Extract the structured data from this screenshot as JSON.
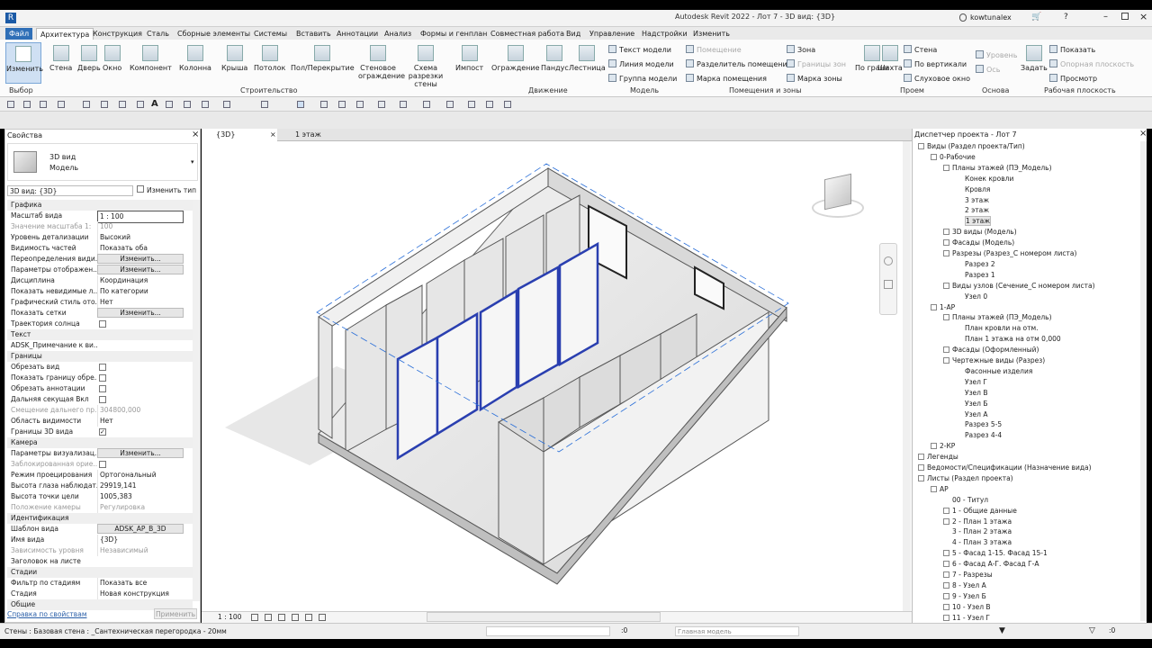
{
  "window": {
    "title": "Autodesk Revit 2022 - Лот 7 - 3D вид: {3D}",
    "user": "kowtunalex"
  },
  "tabs": [
    "Файл",
    "Архитектура",
    "Конструкция",
    "Сталь",
    "Сборные элементы",
    "Системы",
    "Вставить",
    "Аннотации",
    "Анализ",
    "Формы и генплан",
    "Совместная работа",
    "Вид",
    "Управление",
    "Надстройки",
    "Изменить"
  ],
  "ribbon": {
    "select": {
      "modify": "Изменить",
      "select_label": "Выбор"
    },
    "build": [
      "Стена",
      "Дверь",
      "Окно",
      "Компонент",
      "Колонна",
      "Крыша",
      "Потолок",
      "Пол/Перекрытие",
      "Стеновое ограждение",
      "Схема разрезки стены",
      "Импост",
      "Ограждение",
      "Пандус",
      "Лестница"
    ],
    "model_items": [
      "Текст модели",
      "Линия модели",
      "Группа модели"
    ],
    "room_items": [
      "Помещение",
      "Разделитель помещений",
      "Марка помещения"
    ],
    "area_items": [
      "Зона",
      "Границы зон",
      "Марка зоны"
    ],
    "opening_items": [
      "По грани",
      "Шахта",
      "Стена",
      "По вертикали",
      "Слуховое окно"
    ],
    "datum_items": [
      "Уровень",
      "Ось"
    ],
    "wp_items": [
      "Задать",
      "Показать",
      "Опорная плоскость",
      "Просмотр"
    ],
    "groups": [
      "Строительство",
      "Движение",
      "Модель",
      "Помещения и зоны",
      "Проем",
      "Основа",
      "Рабочая плоскость"
    ]
  },
  "properties": {
    "title": "Свойства",
    "type_name": "3D вид",
    "type_sub": "Модель",
    "selector": "3D вид: {3D}",
    "edit_type": "Изменить тип",
    "sections": [
      {
        "name": "Графика",
        "rows": [
          [
            "Масштаб вида",
            "1 : 100"
          ],
          [
            "Значение масштаба    1:",
            "100"
          ],
          [
            "Уровень детализации",
            "Высокий"
          ],
          [
            "Видимость частей",
            "Показать оба"
          ],
          [
            "Переопределения види...",
            "Изменить..."
          ],
          [
            "Параметры отображен...",
            "Изменить..."
          ],
          [
            "Дисциплина",
            "Координация"
          ],
          [
            "Показать невидимые л...",
            "По категории"
          ],
          [
            "Графический стиль ото...",
            "Нет"
          ],
          [
            "Показать сетки",
            "Изменить..."
          ],
          [
            "Траектория солнца",
            ""
          ]
        ]
      },
      {
        "name": "Текст",
        "rows": [
          [
            "ADSK_Примечание к ви...",
            ""
          ]
        ]
      },
      {
        "name": "Границы",
        "rows": [
          [
            "Обрезать вид",
            ""
          ],
          [
            "Показать границу обре...",
            ""
          ],
          [
            "Обрезать аннотации",
            ""
          ],
          [
            "Дальняя секущая Вкл",
            ""
          ],
          [
            "Смещение дальнего пр...",
            "304800,000"
          ],
          [
            "Область видимости",
            "Нет"
          ],
          [
            "Границы 3D вида",
            ""
          ]
        ]
      },
      {
        "name": "Камера",
        "rows": [
          [
            "Параметры визуализац...",
            "Изменить..."
          ],
          [
            "Заблокированная орие...",
            ""
          ],
          [
            "Режим проецирования",
            "Ортогональный"
          ],
          [
            "Высота глаза наблюдат...",
            "29919,141"
          ],
          [
            "Высота точки цели",
            "1005,383"
          ],
          [
            "Положение камеры",
            "Регулировка"
          ]
        ]
      },
      {
        "name": "Идентификация",
        "rows": [
          [
            "Шаблон вида",
            "ADSK_АР_В_3D"
          ],
          [
            "Имя вида",
            "{3D}"
          ],
          [
            "Зависимость уровня",
            "Независимый"
          ],
          [
            "Заголовок на листе",
            ""
          ]
        ]
      },
      {
        "name": "Стадии",
        "rows": [
          [
            "Фильтр по стадиям",
            "Показать все"
          ],
          [
            "Стадия",
            "Новая конструкция"
          ]
        ]
      },
      {
        "name": "Общие",
        "rows": []
      }
    ],
    "help_link": "Справка по свойствам",
    "apply": "Применить"
  },
  "view_tabs": [
    "{3D}",
    "1 этаж"
  ],
  "view_scale": "1 : 100",
  "browser": {
    "title": "Диспетчер проекта - Лот 7",
    "nodes": [
      [
        "Виды (Раздел проекта/Тип)",
        0,
        "minus"
      ],
      [
        "0-Рабочие",
        1,
        "minus"
      ],
      [
        "Планы этажей (ПЭ_Модель)",
        2,
        "minus"
      ],
      [
        "Конек кровли",
        3,
        ""
      ],
      [
        "Кровля",
        3,
        ""
      ],
      [
        "3 этаж",
        3,
        ""
      ],
      [
        "2 этаж",
        3,
        ""
      ],
      [
        "1 этаж",
        3,
        "sel"
      ],
      [
        "3D виды (Модель)",
        2,
        "plus"
      ],
      [
        "Фасады (Модель)",
        2,
        "plus"
      ],
      [
        "Разрезы (Разрез_С номером листа)",
        2,
        "minus"
      ],
      [
        "Разрез 2",
        3,
        ""
      ],
      [
        "Разрез 1",
        3,
        ""
      ],
      [
        "Виды узлов (Сечение_С номером листа)",
        2,
        "minus"
      ],
      [
        "Узел 0",
        3,
        ""
      ],
      [
        "1-АР",
        1,
        "minus"
      ],
      [
        "Планы этажей (ПЭ_Модель)",
        2,
        "minus"
      ],
      [
        "План кровли на отм.",
        3,
        ""
      ],
      [
        "План 1 этажа на отм 0,000",
        3,
        ""
      ],
      [
        "Фасады (Оформленный)",
        2,
        "plus"
      ],
      [
        "Чертежные виды (Разрез)",
        2,
        "minus"
      ],
      [
        "Фасонные изделия",
        3,
        ""
      ],
      [
        "Узел Г",
        3,
        ""
      ],
      [
        "Узел В",
        3,
        ""
      ],
      [
        "Узел Б",
        3,
        ""
      ],
      [
        "Узел А",
        3,
        ""
      ],
      [
        "Разрез 5-5",
        3,
        ""
      ],
      [
        "Разрез 4-4",
        3,
        ""
      ],
      [
        "2-КР",
        1,
        "plus"
      ],
      [
        "Легенды",
        0,
        "plus"
      ],
      [
        "Ведомости/Спецификации (Назначение вида)",
        0,
        "plus"
      ],
      [
        "Листы (Раздел проекта)",
        0,
        "minus"
      ],
      [
        "АР",
        1,
        "minus"
      ],
      [
        "00 - Титул",
        2,
        ""
      ],
      [
        "1 - Общие данные",
        2,
        "plus"
      ],
      [
        "2 - План 1 этажа",
        2,
        "plus"
      ],
      [
        "3 - План 2 этажа",
        2,
        ""
      ],
      [
        "4 - План 3 этажа",
        2,
        ""
      ],
      [
        "5 - Фасад 1-15. Фасад 15-1",
        2,
        "plus"
      ],
      [
        "6 - Фасад А-Г. Фасад Г-А",
        2,
        "plus"
      ],
      [
        "7 - Разрезы",
        2,
        "plus"
      ],
      [
        "8 - Узел А",
        2,
        "plus"
      ],
      [
        "9 - Узел Б",
        2,
        "plus"
      ],
      [
        "10 - Узел В",
        2,
        "plus"
      ],
      [
        "11 - Узел Г",
        2,
        "plus"
      ]
    ]
  },
  "status": {
    "text": "Стены : Базовая стена : _Сантехническая перегородка - 20мм",
    "zero": ":0",
    "model": "Главная модель"
  },
  "colors": {
    "file_tab": "#2f6fb7",
    "selection_blue": "#2a3fb0",
    "link": "#2a5fa8"
  }
}
